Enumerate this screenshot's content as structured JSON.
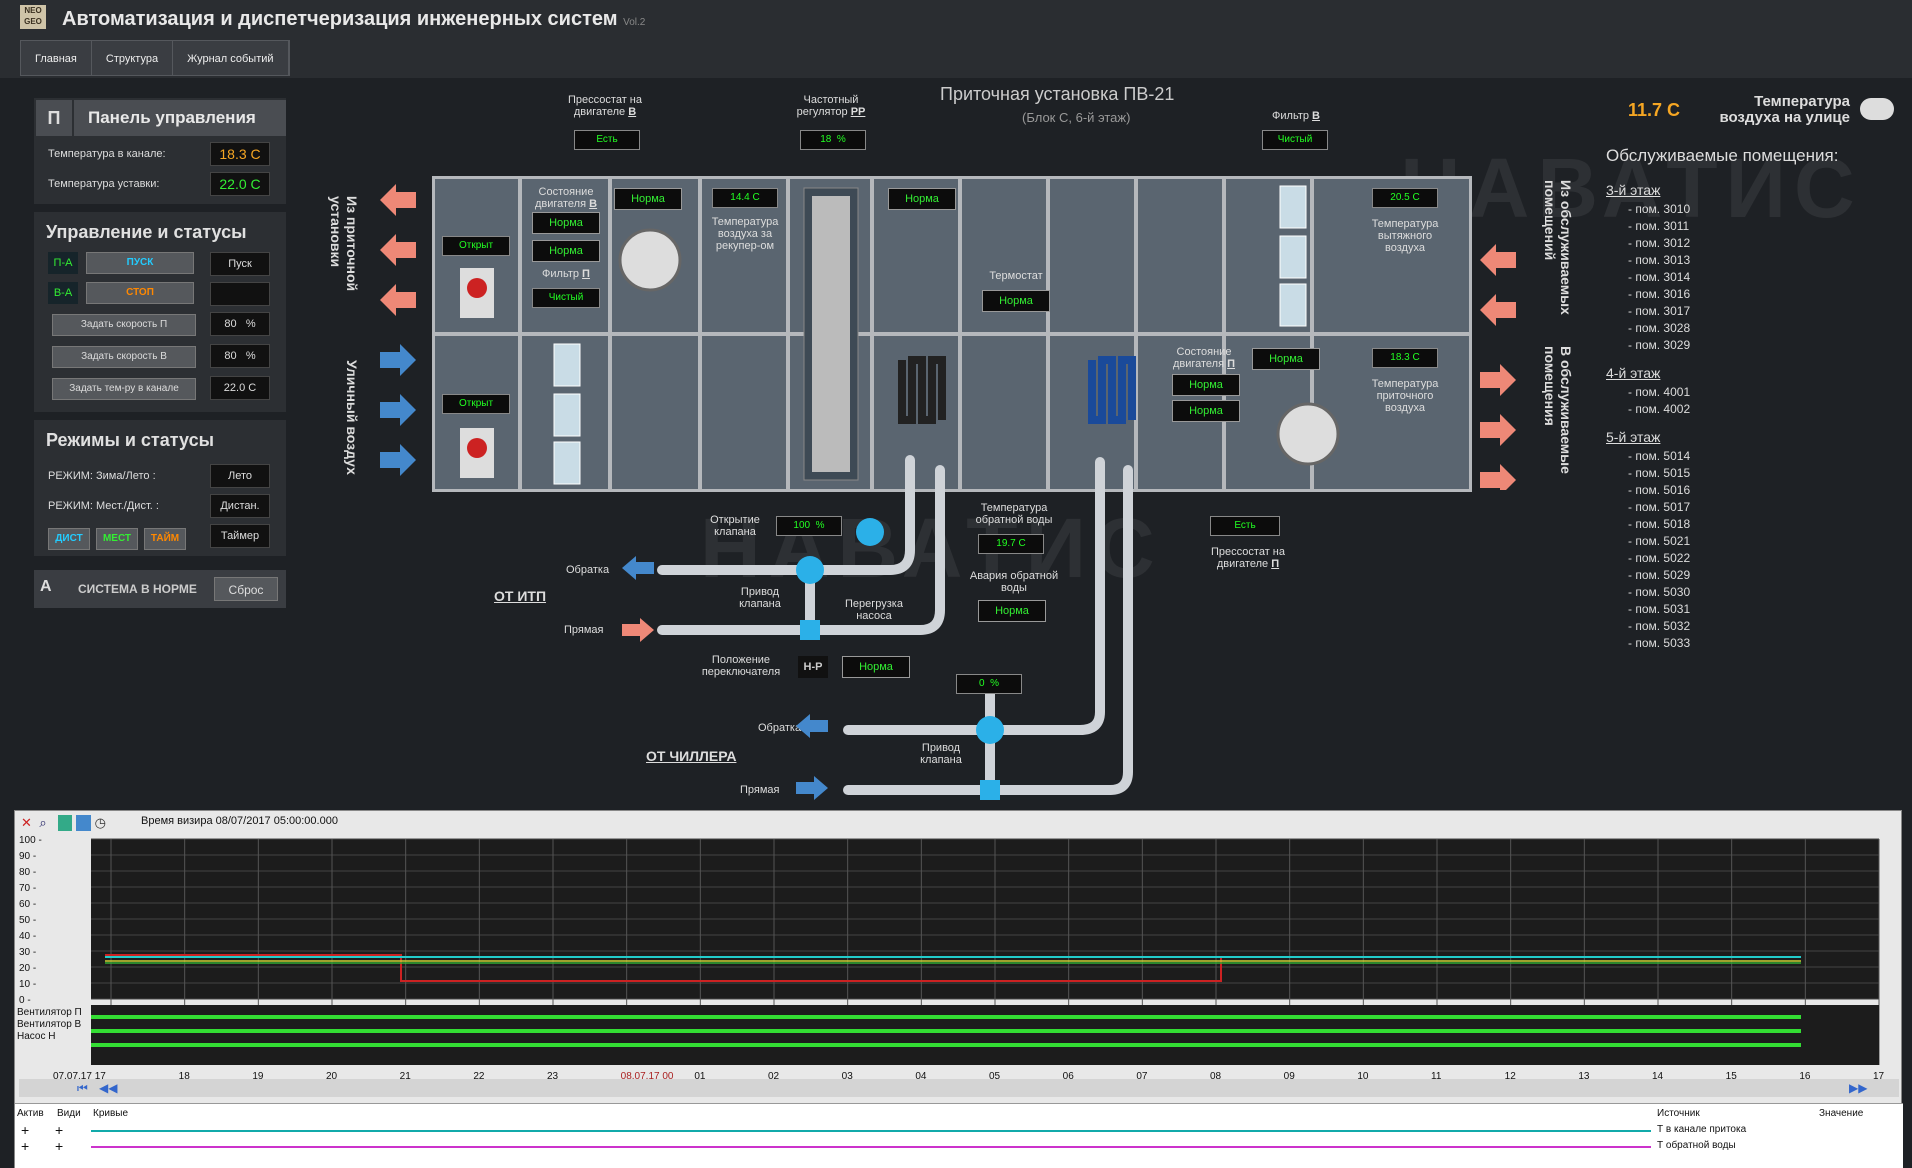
{
  "header": {
    "logo": "NEO GEO",
    "title": "Автоматизация и диспетчеризация инженерных систем",
    "version": "Vol.2"
  },
  "menu": [
    "Главная",
    "Структура",
    "Журнал событий"
  ],
  "control_panel": {
    "letter": "П",
    "title": "Панель управления",
    "t_channel_label": "Температура в канале:",
    "t_channel": "18.3 C",
    "t_set_label": "Температура уставки:",
    "t_set": "22.0 C"
  },
  "status_section": {
    "title": "Управление и статусы",
    "pa": "П-А",
    "start": "ПУСК",
    "start_val": "Пуск",
    "ba": "В-А",
    "stop": "СТОП",
    "speed_p": "Задать скорость П",
    "speed_p_val": "80",
    "speed_b": "Задать скорость В",
    "speed_b_val": "80",
    "pct": "%",
    "temp_ch": "Задать тем-ру в канале",
    "temp_ch_val": "22.0 C"
  },
  "modes": {
    "title": "Режимы и статусы",
    "m1": "РЕЖИМ: Зима/Лето :",
    "m1v": "Лето",
    "m2": "РЕЖИМ: Мест./Дист. :",
    "m2v": "Дистан.",
    "dist": "ДИСТ",
    "mest": "МЕСТ",
    "time": "ТАЙМ",
    "timer": "Таймер"
  },
  "alarm": {
    "letter": "А",
    "text": "СИСТЕМА В НОРМЕ",
    "reset": "Сброс"
  },
  "scheme": {
    "title": "Приточная установка ПВ-21",
    "subtitle": "(Блок С, 6-й этаж)",
    "watermark": "НАВАТИС",
    "from_supply": "Из приточной установки",
    "street_air": "Уличный воздух",
    "from_rooms": "Из обслуживаемых помещений",
    "to_rooms": "В обслуживаемые помещения",
    "press_b_lbl": "Прессостат на двигателе",
    "press_b_sub": "В",
    "press_b": "Есть",
    "freq_lbl": "Частотный регулятор",
    "freq_sub": "РР",
    "freq": "18",
    "freq_u": "%",
    "filter_b_lbl": "Фильтр",
    "filter_b_sub": "В",
    "filter_b": "Чистый",
    "damper1": "Открыт",
    "damper2": "Открыт",
    "motor_b_lbl": "Состояние двигателя",
    "motor_b_sub": "В",
    "motor_b1": "Норма",
    "motor_b2": "Норма",
    "filter_p_lbl": "Фильтр",
    "filter_p_sub": "П",
    "filter_p": "Чистый",
    "norm_top1": "Норма",
    "recup_t": "14.4 C",
    "recup_lbl": "Температура воздуха за рекупер-ом",
    "norm_top2": "Норма",
    "thermostat_lbl": "Термостат",
    "thermostat": "Норма",
    "exhaust_t": "20.5 C",
    "exhaust_lbl": "Температура вытяжного воздуха",
    "motor_p_lbl": "Состояние двигателя",
    "motor_p_sub": "П",
    "motor_p0": "Норма",
    "motor_p1": "Норма",
    "motor_p2": "Норма",
    "supply_t": "18.3 C",
    "supply_lbl": "Температура приточного воздуха",
    "press_p_lbl": "Прессостат на двигателе",
    "press_p_sub": "П",
    "press_p": "Есть",
    "valve_open_lbl": "Открытие клапана",
    "valve_open": "100",
    "valve_open_u": "%",
    "return_t_lbl": "Температура обратной воды",
    "return_t": "19.7 C",
    "return_alarm_lbl": "Авария обратной воды",
    "return_alarm": "Норма",
    "obratka": "Обратка",
    "pryamaya": "Прямая",
    "ot_itp": "ОТ ИТП",
    "drive_lbl": "Привод клапана",
    "pump_lbl": "Перегрузка насоса",
    "switch_lbl": "Положение переключателя",
    "switch_pos": "Н-Р",
    "switch_val": "Норма",
    "chiller_valve": "0",
    "chiller_valve_u": "%",
    "ot_chiller": "ОТ ЧИЛЛЕРА",
    "chiller_drive_lbl": "Привод клапана",
    "obratka2": "Обратка",
    "pryamaya2": "Прямая"
  },
  "outdoor": {
    "value": "11.7 C",
    "label": "Температура воздуха на улице"
  },
  "rooms": {
    "title": "Обслуживаемые помещения:",
    "floors": [
      {
        "name": "3-й этаж",
        "items": [
          "- пом. 3010",
          "- пом. 3011",
          "- пом. 3012",
          "- пом. 3013",
          "- пом. 3014",
          "- пом. 3016",
          "- пом. 3017",
          "- пом. 3028",
          "- пом. 3029"
        ]
      },
      {
        "name": "4-й этаж",
        "items": [
          "- пом. 4001",
          "- пом. 4002"
        ]
      },
      {
        "name": "5-й этаж",
        "items": [
          "- пом. 5014",
          "- пом. 5015",
          "- пом. 5016",
          "- пом. 5017",
          "- пом. 5018",
          "- пом. 5021",
          "- пом. 5022",
          "- пом. 5029",
          "- пом. 5030",
          "- пом. 5031",
          "- пом. 5032",
          "- пом. 5033"
        ]
      }
    ]
  },
  "trend": {
    "time_label": "Время визира 08/07/2017 05:00:00.000",
    "y_ticks": [
      "100 -",
      "90 -",
      "80 -",
      "70 -",
      "60 -",
      "50 -",
      "40 -",
      "30 -",
      "20 -",
      "10 -",
      "0 -"
    ],
    "digital": [
      "Вентилятор П",
      "Вентилятор В",
      "Насос Н"
    ],
    "x_ticks": [
      "07.07.17 17",
      "18",
      "19",
      "20",
      "21",
      "22",
      "23",
      "08.07.17 00",
      "01",
      "02",
      "03",
      "04",
      "05",
      "06",
      "07",
      "08",
      "09",
      "10",
      "11",
      "12",
      "13",
      "14",
      "15",
      "16",
      "17"
    ],
    "cols": {
      "active": "Актив",
      "visible": "Види",
      "curves": "Кривые",
      "source": "Источник",
      "value": "Значение"
    },
    "rows": [
      {
        "mark": "+",
        "source": "Т в канале притока",
        "color": "#1aa"
      },
      {
        "mark": "+",
        "source": "Т обратной воды",
        "color": "#c3c"
      }
    ]
  }
}
